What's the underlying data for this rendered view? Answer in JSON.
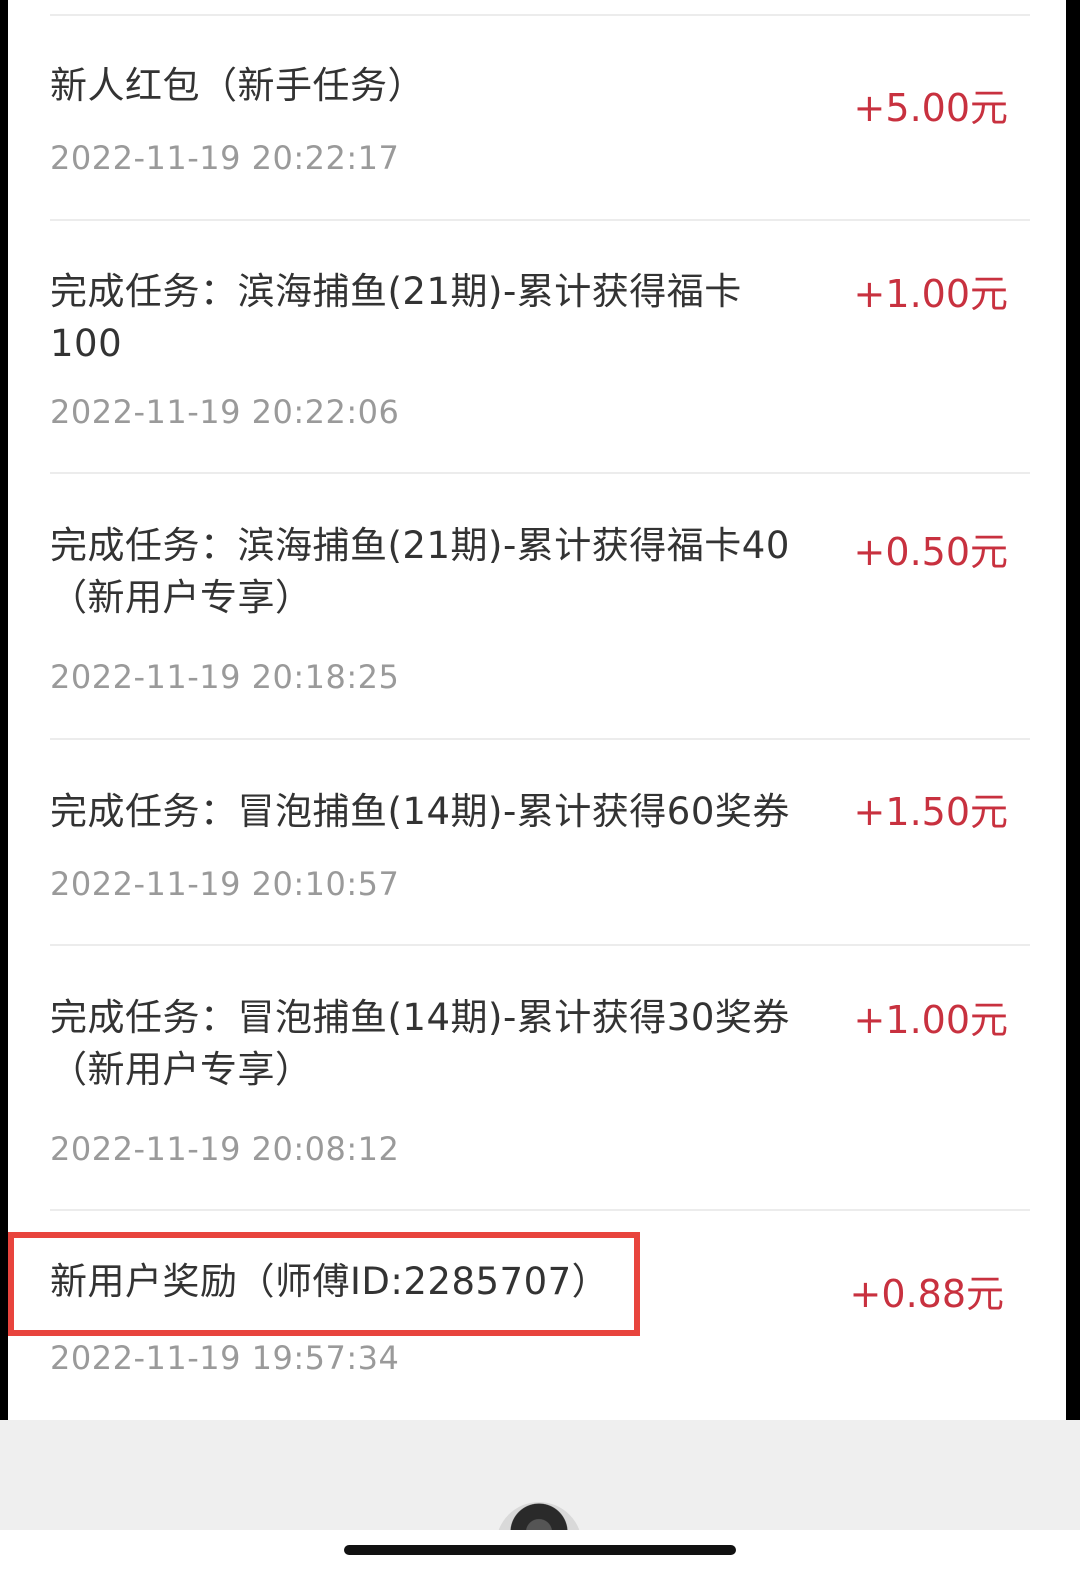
{
  "records": [
    {
      "title": "新人红包（新手任务）",
      "amount": "+5.00元",
      "time": "2022-11-19 20:22:17"
    },
    {
      "title": "完成任务：滨海捕鱼(21期)-累计获得福卡100",
      "amount": "+1.00元",
      "time": "2022-11-19 20:22:06"
    },
    {
      "title": "完成任务：滨海捕鱼(21期)-累计获得福卡40（新用户专享）",
      "amount": "+0.50元",
      "time": "2022-11-19 20:18:25"
    },
    {
      "title": "完成任务：冒泡捕鱼(14期)-累计获得60奖券",
      "amount": "+1.50元",
      "time": "2022-11-19 20:10:57"
    },
    {
      "title": "完成任务：冒泡捕鱼(14期)-累计获得30奖券（新用户专享）",
      "amount": "+1.00元",
      "time": "2022-11-19 20:08:12"
    },
    {
      "title": "新用户奖励（师傅ID:2285707）",
      "amount": "+0.88元",
      "time": "2022-11-19 19:57:34"
    }
  ],
  "colors": {
    "amount": "#c8313f",
    "highlight": "#e8443d",
    "time": "#9a9a9a",
    "title": "#333333"
  },
  "icons": {
    "avatar": "avatar-image",
    "home_indicator": "home-indicator-bar"
  }
}
